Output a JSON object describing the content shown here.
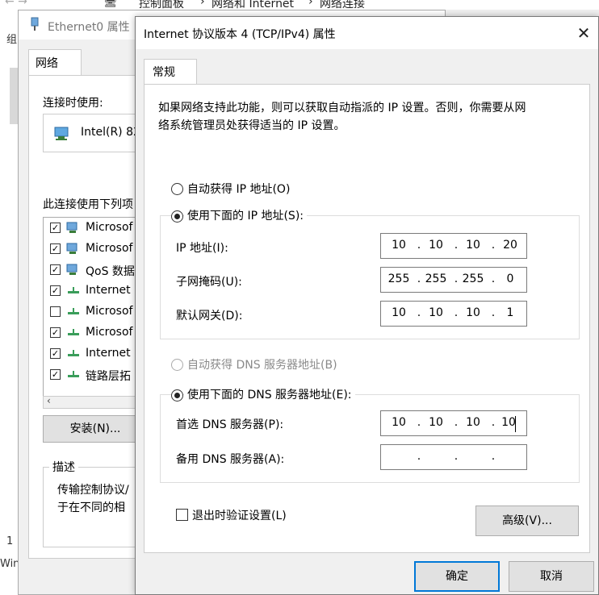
{
  "explorer": {
    "nav_arrows": "←  →",
    "breadcrumb": [
      "控制面板",
      "网络和 Internet",
      "网络连接"
    ],
    "left_letters": [
      "组",
      "1",
      "Win"
    ]
  },
  "eth_window": {
    "title": "Ethernet0 属性",
    "tab": "网络",
    "connect_using_label": "连接时使用:",
    "adapter_name": "Intel(R) 82",
    "items_label": "此连接使用下列项",
    "items": [
      {
        "label": "Microsof",
        "checked": true
      },
      {
        "label": "Microsof",
        "checked": true
      },
      {
        "label": "QoS 数据",
        "checked": true
      },
      {
        "label": "Internet",
        "checked": true
      },
      {
        "label": "Microsof",
        "checked": false
      },
      {
        "label": "Microsof",
        "checked": true
      },
      {
        "label": "Internet",
        "checked": true
      },
      {
        "label": "链路层拓",
        "checked": true
      }
    ],
    "install_button": "安装(N)...",
    "description_label": "描述",
    "description_line1": "传输控制协议/",
    "description_line2": "于在不同的相"
  },
  "dialog": {
    "title": "Internet 协议版本 4 (TCP/IPv4) 属性",
    "close_glyph": "✕",
    "tab": "常规",
    "description_line1": "如果网络支持此功能，则可以获取自动指派的 IP 设置。否则，你需要从网",
    "description_line2": "络系统管理员处获得适当的 IP 设置。",
    "auto_ip_label": "自动获得 IP 地址(O)",
    "manual_ip_label": "使用下面的 IP 地址(S):",
    "ip_label": "IP 地址(I):",
    "ip_value": [
      "10",
      "10",
      "10",
      "20"
    ],
    "subnet_label": "子网掩码(U):",
    "subnet_value": [
      "255",
      "255",
      "255",
      "0"
    ],
    "gateway_label": "默认网关(D):",
    "gateway_value": [
      "10",
      "10",
      "10",
      "1"
    ],
    "auto_dns_label": "自动获得 DNS 服务器地址(B)",
    "manual_dns_label": "使用下面的 DNS 服务器地址(E):",
    "preferred_dns_label": "首选 DNS 服务器(P):",
    "preferred_dns_value": [
      "10",
      "10",
      "10",
      "10"
    ],
    "alternate_dns_label": "备用 DNS 服务器(A):",
    "alternate_dns_value": [
      "",
      "",
      "",
      ""
    ],
    "validate_label": "退出时验证设置(L)",
    "advanced_button": "高级(V)...",
    "ok_button": "确定",
    "cancel_button": "取消",
    "dot": "."
  },
  "colors": {
    "focus_border": "#0078d7",
    "disabled_text": "#8a8a8a"
  }
}
